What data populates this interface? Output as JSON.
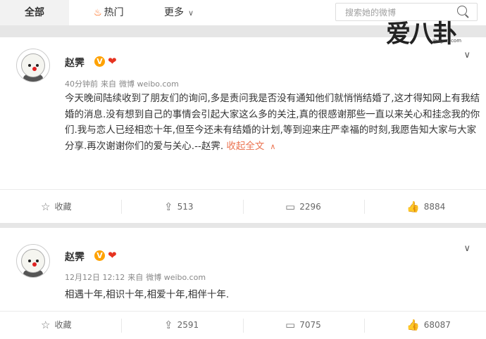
{
  "nav": {
    "tab_all": "全部",
    "tab_hot": "热门",
    "tab_more": "更多",
    "search_placeholder": "搜索她的微博"
  },
  "watermark": {
    "text": "爱八卦",
    "domain": "ibagua.com"
  },
  "posts": [
    {
      "author": "赵霁",
      "verified_icon": "V",
      "heart_icon": "heart-badge",
      "meta": {
        "time": "40分钟前",
        "from": "来自",
        "source": "微博 weibo.com"
      },
      "text": "今天晚间陆续收到了朋友们的询问,多是责问我是否没有通知他们就悄悄结婚了,这才得知网上有我结婚的消息.没有想到自己的事情会引起大家这么多的关注,真的很感谢那些一直以来关心和挂念我的你们.我与恋人已经相恋十年,但至今还未有结婚的计划,等到迎来庄严幸福的时刻,我愿告知大家与大家分享.再次谢谢你们的爱与关心.--赵霁.",
      "collapse_label": "收起全文",
      "actions": {
        "favorite": "收藏",
        "repost": "513",
        "comment": "2296",
        "like": "8884"
      }
    },
    {
      "author": "赵霁",
      "verified_icon": "V",
      "heart_icon": "heart-badge",
      "meta": {
        "time": "12月12日 12:12",
        "from": "来自",
        "source": "微博 weibo.com"
      },
      "text": "相遇十年,相识十年,相爱十年,相伴十年.",
      "actions": {
        "favorite": "收藏",
        "repost": "2591",
        "comment": "7075",
        "like": "68087"
      }
    }
  ],
  "colors": {
    "accent": "#eb7350",
    "verified": "#ffa200",
    "hot": "#ff5a00"
  }
}
